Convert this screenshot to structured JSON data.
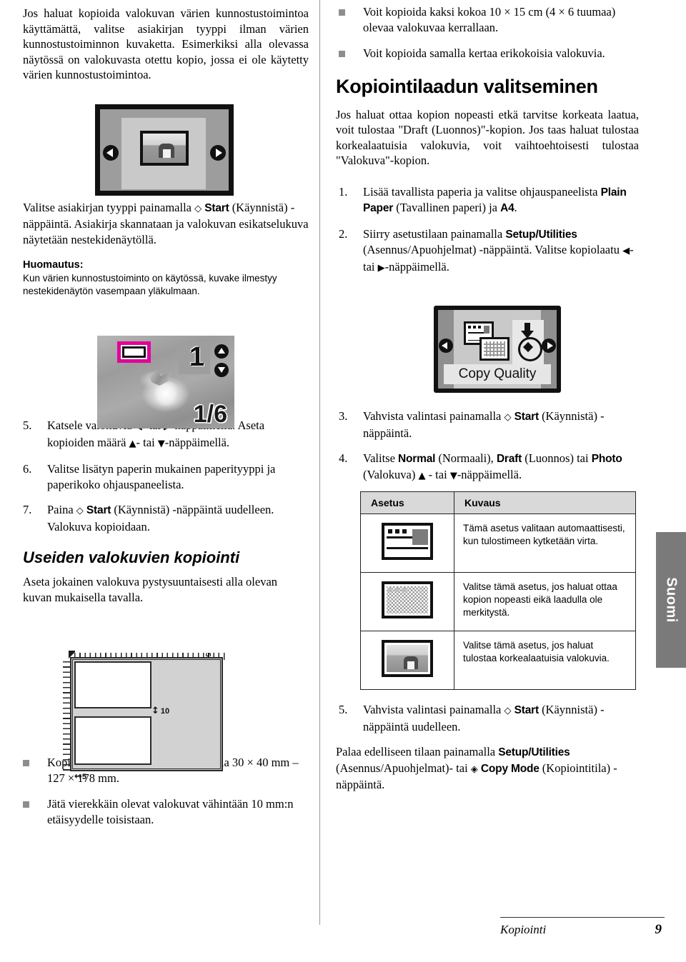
{
  "document": {
    "language_tab": "Suomi",
    "footer": {
      "chapter": "Kopiointi",
      "page_number": "9"
    }
  },
  "left_column": {
    "intro_paragraph": "Jos haluat kopioida valokuvan värien kunnostustoimintoa käyttämättä, valitse asiakirjan tyyppi ilman värien kunnostustoiminnon kuvaketta. Esimerkiksi alla olevassa näytössä on valokuvasta otettu kopio, jossa ei ole käytetty värien kunnostustoimintoa.",
    "lcd_preview": {
      "name": "valokuvan esikatselu",
      "left_arrow": "◀",
      "right_arrow": "▶"
    },
    "after_figure_paragraph_a": "Valitse asiakirjan tyyppi painamalla ",
    "after_figure_start": "Start",
    "after_figure_paragraph_b": " (Käynnistä) -näppäintä. Asiakirja skannataan ja valokuvan esikatselukuva näytetään nestekidenäytöllä.",
    "note": {
      "title": "Huomautus:",
      "body": "Kun värien kunnostustoiminto on käytössä, kuvake ilmestyy nestekidenäytön vasempaan yläkulmaan."
    },
    "lcd_photo": {
      "copies_count": "1",
      "page_indicator": "1/6",
      "restore_icon_name": "värien kunnostus -kuvake"
    },
    "steps": [
      {
        "num": "5.",
        "parts": [
          {
            "t": "Katsele valokuvia "
          },
          {
            "t": "◀",
            "s": "glyph"
          },
          {
            "t": "- tai "
          },
          {
            "t": "▶",
            "s": "glyph"
          },
          {
            "t": "-näppäimellä. Aseta kopioiden määrä "
          },
          {
            "t": "▲",
            "s": "glyph"
          },
          {
            "t": "- tai "
          },
          {
            "t": "▼",
            "s": "glyph"
          },
          {
            "t": "-näppäimellä."
          }
        ]
      },
      {
        "num": "6.",
        "parts": [
          {
            "t": "Valitse lisätyn paperin mukainen paperityyppi ja paperikoko ohjauspaneelista."
          }
        ]
      },
      {
        "num": "7.",
        "parts": [
          {
            "t": "Paina "
          },
          {
            "t": "◇",
            "s": "glyph"
          },
          {
            "t": " "
          },
          {
            "t": "Start",
            "s": "ui"
          },
          {
            "t": " (Käynnistä) -näppäintä uudelleen. Valokuva kopioidaan."
          }
        ]
      }
    ],
    "subsection": {
      "heading": "Useiden valokuvien kopiointi",
      "paragraph": "Aseta jokainen valokuva pystysuuntaisesti alla olevan kuvan mukaisella tavalla."
    },
    "scanner_diagram": {
      "name": "skannaustason asettelukuva",
      "gap_label": "10",
      "margin_label": "5",
      "top_margin_label": "5"
    },
    "bullets": [
      "Kopioitavien valokuvien koko voi olla 30 × 40 mm – 127 × 178 mm.",
      "Jätä vierekkäin olevat valokuvat vähintään 10 mm:n etäisyydelle toisistaan."
    ]
  },
  "right_column": {
    "bullets": [
      "Voit kopioida kaksi kokoa 10 × 15 cm (4 × 6 tuumaa) olevaa valokuvaa kerrallaan.",
      "Voit kopioida samalla kertaa erikokoisia valokuvia."
    ],
    "section_heading": "Kopiointilaadun valitseminen",
    "section_paragraph": "Jos haluat ottaa kopion nopeasti etkä tarvitse korkeata laatua, voit tulostaa \"Draft (Luonnos)\"-kopion. Jos taas haluat tulostaa korkealaatuisia valokuvia, voit vaihtoehtoisesti tulostaa \"Valokuva\"-kopion.",
    "steps": [
      {
        "num": "1.",
        "parts": [
          {
            "t": "Lisää tavallista paperia ja valitse ohjauspaneelista "
          },
          {
            "t": "Plain Paper",
            "s": "ui"
          },
          {
            "t": " (Tavallinen paperi) ja "
          },
          {
            "t": "A4",
            "s": "ui"
          },
          {
            "t": "."
          }
        ]
      },
      {
        "num": "2.",
        "parts": [
          {
            "t": "Siirry asetustilaan painamalla "
          },
          {
            "t": "Setup/Utilities",
            "s": "ui"
          },
          {
            "t": " (Asennus/Apuohjelmat) -näppäintä. Valitse kopiolaatu "
          },
          {
            "t": "◀",
            "s": "glyph"
          },
          {
            "t": "- tai "
          },
          {
            "t": "▶",
            "s": "glyph"
          },
          {
            "t": "-näppäimellä."
          }
        ]
      },
      {
        "num": "3.",
        "parts": [
          {
            "t": "Vahvista valintasi painamalla "
          },
          {
            "t": "◇",
            "s": "glyph"
          },
          {
            "t": " "
          },
          {
            "t": "Start",
            "s": "ui"
          },
          {
            "t": " (Käynnistä) -näppäintä."
          }
        ]
      },
      {
        "num": "4.",
        "parts": [
          {
            "t": "Valitse "
          },
          {
            "t": "Normal",
            "s": "ui"
          },
          {
            "t": " (Normaali), "
          },
          {
            "t": "Draft",
            "s": "ui"
          },
          {
            "t": " (Luonnos) tai "
          },
          {
            "t": "Photo",
            "s": "ui"
          },
          {
            "t": " (Valokuva) "
          },
          {
            "t": "▲",
            "s": "glyph"
          },
          {
            "t": " - tai "
          },
          {
            "t": "▼",
            "s": "glyph"
          },
          {
            "t": "-näppäimellä."
          }
        ]
      },
      {
        "num": "5.",
        "parts": [
          {
            "t": "Vahvista valintasi painamalla "
          },
          {
            "t": "◇",
            "s": "glyph"
          },
          {
            "t": " "
          },
          {
            "t": "Start",
            "s": "ui"
          },
          {
            "t": " (Käynnistä) -näppäintä uudelleen."
          }
        ]
      }
    ],
    "lcd_copy_quality": {
      "label": "Copy Quality",
      "left_arrow": "◀",
      "right_arrow": "▶"
    },
    "table": {
      "headers": [
        "Asetus",
        "Kuvaus"
      ],
      "rows": [
        {
          "icon": "normal-quality-icon",
          "description": "Tämä asetus valitaan automaattisesti, kun tulostimeen kytketään virta."
        },
        {
          "icon": "draft-quality-icon",
          "description": "Valitse tämä asetus, jos haluat ottaa kopion nopeasti eikä laadulla ole merkitystä."
        },
        {
          "icon": "photo-quality-icon",
          "description": "Valitse tämä asetus, jos haluat tulostaa korkealaatuisia valokuvia."
        }
      ]
    },
    "closing_parts": [
      {
        "t": "Palaa edelliseen tilaan painamalla "
      },
      {
        "t": "Setup/Utilities",
        "s": "ui"
      },
      {
        "t": " (Asennus/Apuohjelmat)- tai "
      },
      {
        "t": "◈",
        "s": "glyph"
      },
      {
        "t": " "
      },
      {
        "t": "Copy Mode",
        "s": "ui"
      },
      {
        "t": " (Kopiointitila) -näppäintä."
      }
    ]
  }
}
